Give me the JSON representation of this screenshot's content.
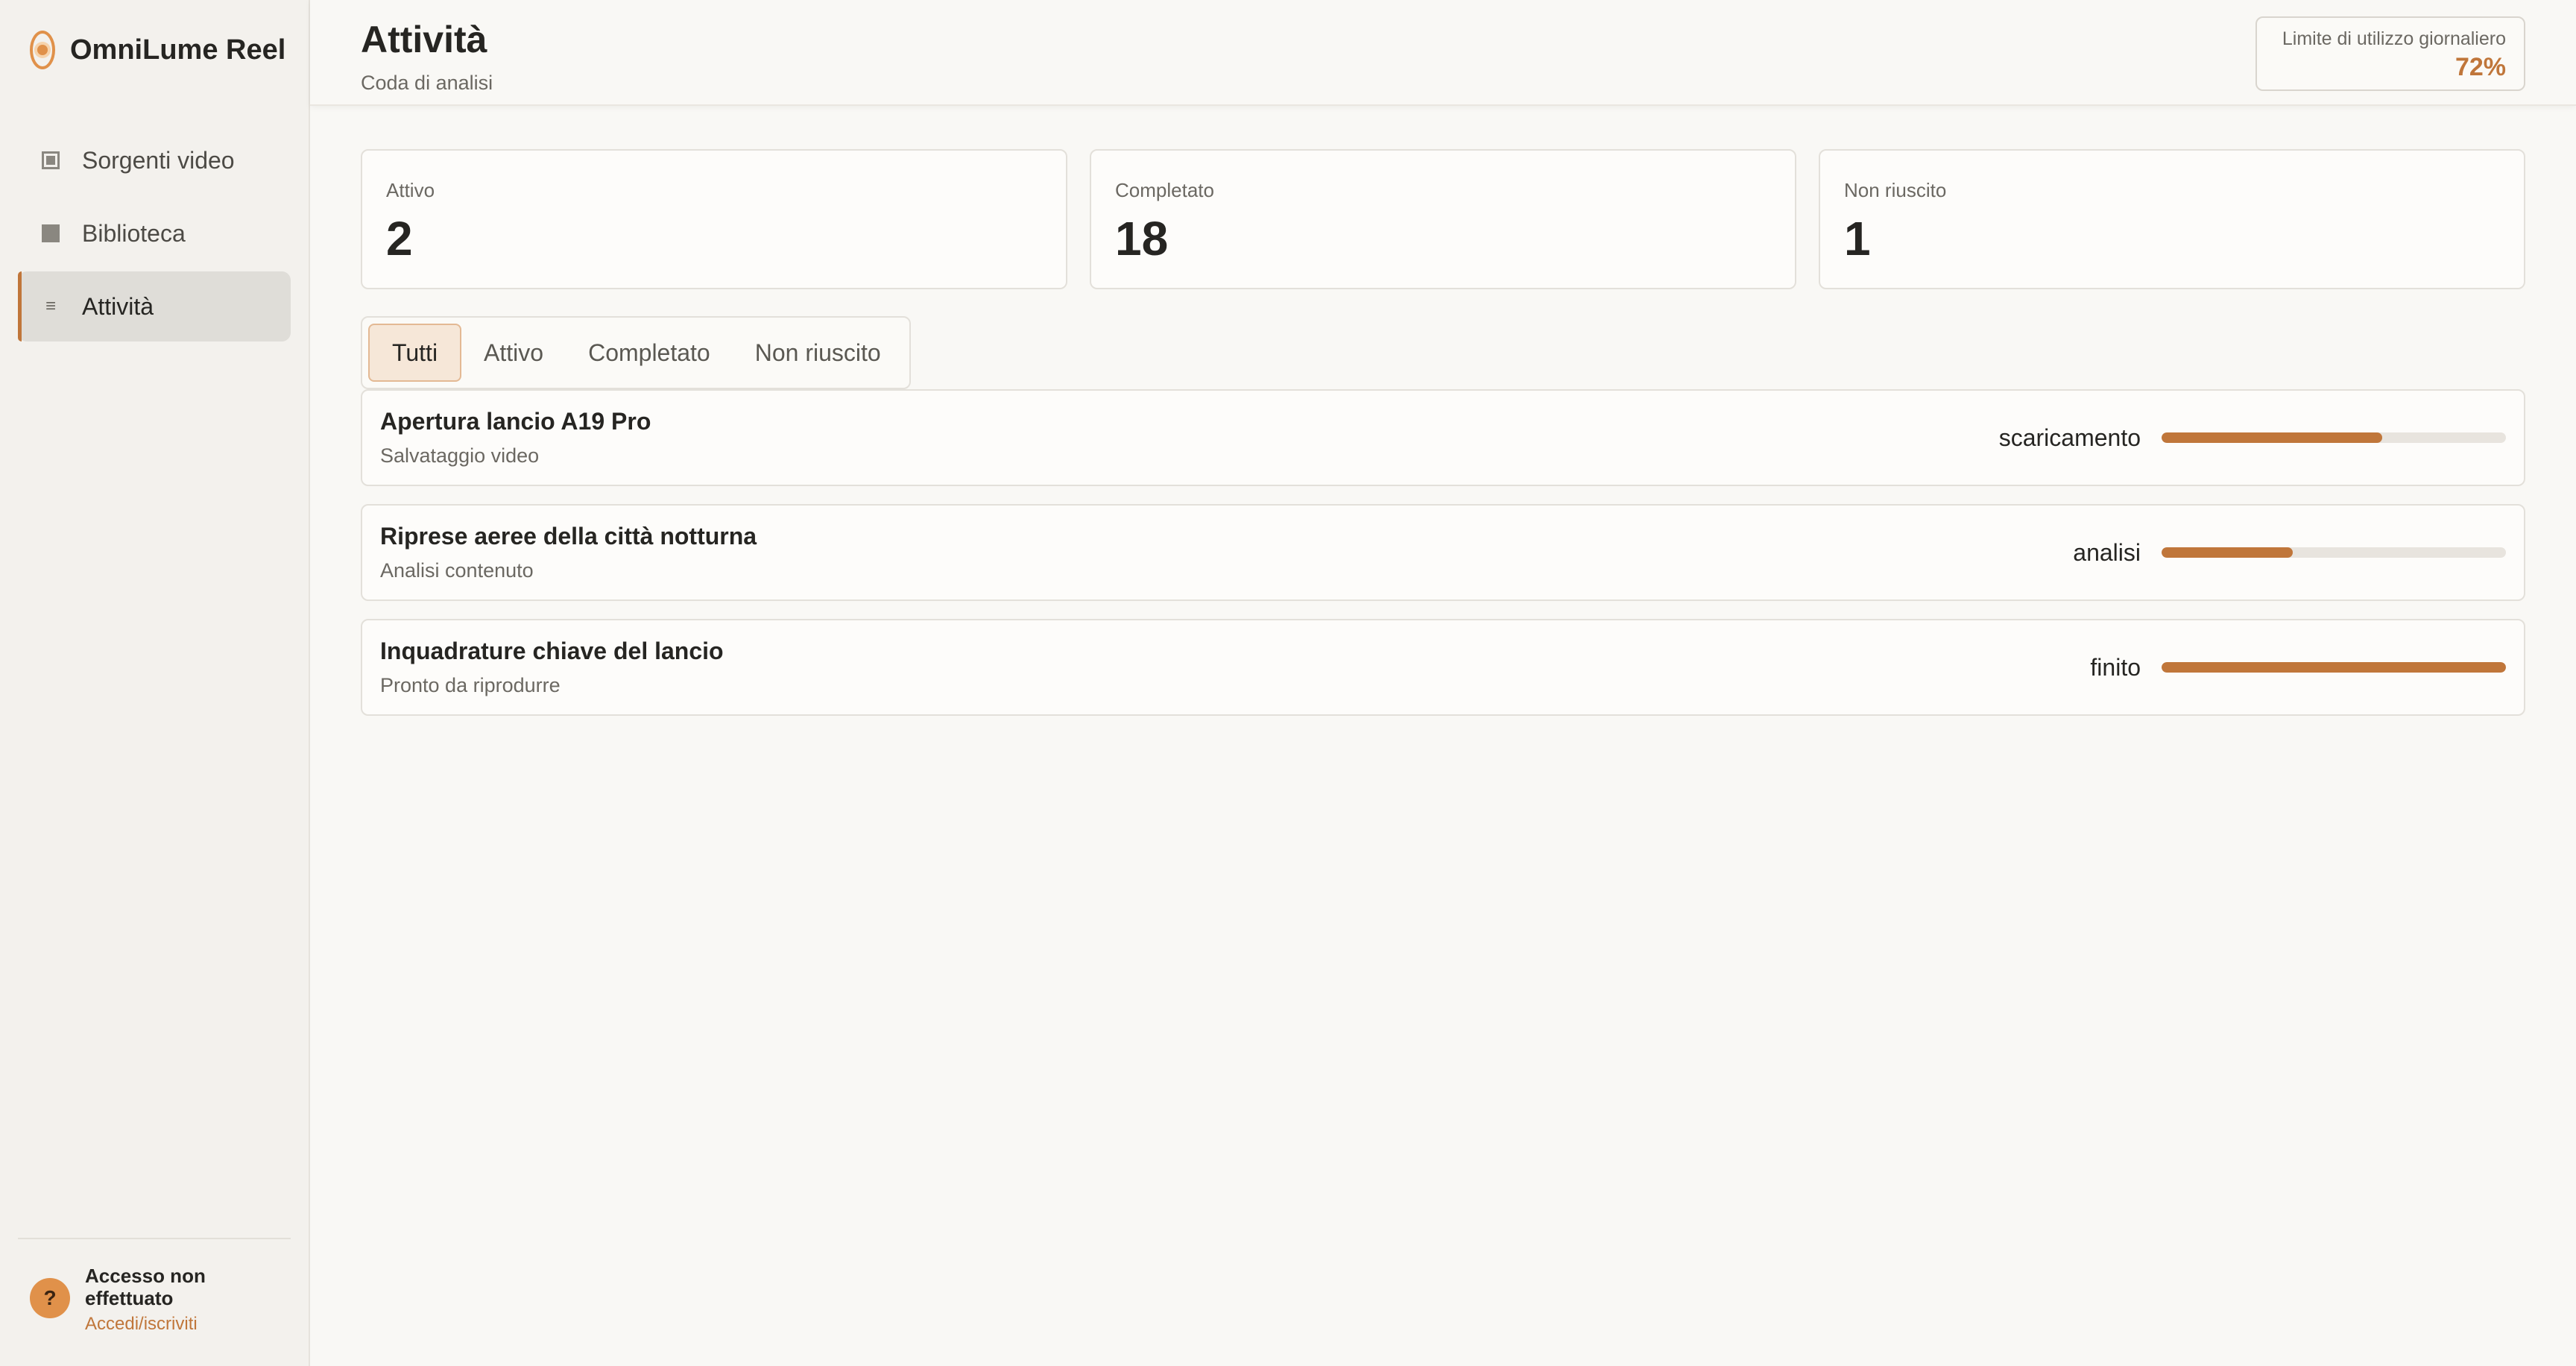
{
  "app": {
    "name": "OmniLume Reel"
  },
  "sidebar": {
    "items": [
      {
        "label": "Sorgenti video",
        "icon": "video-source-icon",
        "active": false
      },
      {
        "label": "Biblioteca",
        "icon": "library-icon",
        "active": false
      },
      {
        "label": "Attività",
        "icon": "list-icon",
        "active": true
      }
    ],
    "user": {
      "avatar_symbol": "?",
      "status": "Accesso non effettuato",
      "login_link": "Accedi/iscriviti"
    }
  },
  "header": {
    "title": "Attività",
    "subtitle": "Coda di analisi",
    "usage": {
      "label": "Limite di utilizzo giornaliero",
      "value": "72%"
    }
  },
  "stats": [
    {
      "label": "Attivo",
      "value": "2"
    },
    {
      "label": "Completato",
      "value": "18"
    },
    {
      "label": "Non riuscito",
      "value": "1"
    }
  ],
  "tabs": [
    {
      "label": "Tutti",
      "active": true
    },
    {
      "label": "Attivo",
      "active": false
    },
    {
      "label": "Completato",
      "active": false
    },
    {
      "label": "Non riuscito",
      "active": false
    }
  ],
  "tasks": [
    {
      "title": "Apertura lancio A19 Pro",
      "subtitle": "Salvataggio video",
      "status": "scaricamento",
      "progress": 0.64
    },
    {
      "title": "Riprese aeree della città notturna",
      "subtitle": "Analisi contenuto",
      "status": "analisi",
      "progress": 0.38
    },
    {
      "title": "Inquadrature chiave del lancio",
      "subtitle": "Pronto da riprodurre",
      "status": "finito",
      "progress": 1.0
    }
  ],
  "colors": {
    "accent": "#c0763a",
    "track": "#e8e4de",
    "tab_active_bg": "#f6e7d8"
  }
}
